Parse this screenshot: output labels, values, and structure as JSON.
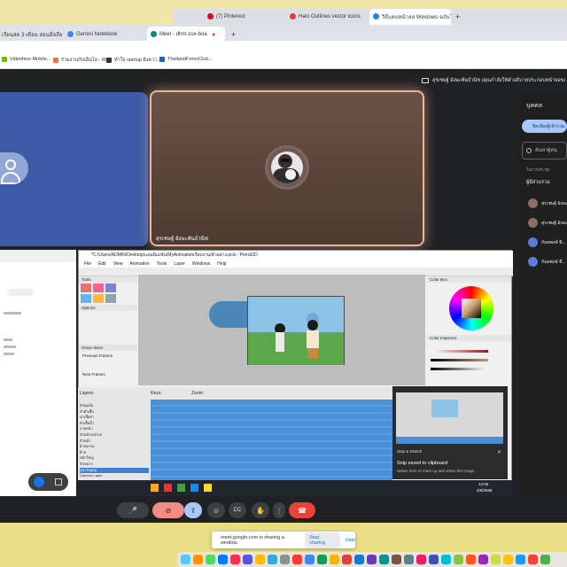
{
  "browser_back": {
    "tabs": [
      {
        "label": "(7) Pinterest",
        "color": "#e60023"
      },
      {
        "label": "Hats Outlines vector icons",
        "color": "#e53935"
      },
      {
        "label": "วิธีแคปหน้าจอ Windows ฉบับไม่...",
        "color": "#1e88e5"
      }
    ],
    "new_tab": "+"
  },
  "browser_front": {
    "tabs": [
      {
        "label": "เรียนสด 3 เดือน สอนมือถือ C...",
        "color": "#f4b400"
      },
      {
        "label": "Gemini Notebook",
        "color": "#4285f4"
      },
      {
        "label": "Meet - dhm-zux-boa",
        "color": "#00897b"
      }
    ],
    "recording_dot": "●",
    "new_tab": "+",
    "bookmarks": [
      {
        "label": "Videohive Mobile...",
        "color": "#76b900"
      },
      {
        "label": "ร่วมงานกับเอ็มไอ - W...",
        "color": "#ff7043"
      },
      {
        "label": "ทำใจ startup ยิงควา...",
        "color": "#333333"
      },
      {
        "label": "ThailandForexClub...",
        "color": "#1565c0"
      }
    ]
  },
  "meet": {
    "presenting_banner": "สุรเชษฐ์ อังษะพันธ์วนิช (คุณกำลังให้คำอธิบายประกอบหน้าจอของคุณ)",
    "presenter_name": "สุรเชษฐ์ อังษะพันธ์วนิช",
    "people_panel": {
      "title": "บุคคล",
      "pill": "ปิดเสียงผู้เข้าร่วม",
      "search_placeholder": "ค้นหาผู้คน",
      "section": "ในการประชุม",
      "group_label": "ผู้มีส่วนร่วม",
      "people": [
        "สุรเชษฐ์ อังษะ...",
        "สุรเชษฐ์ อังษะ...",
        "กันตพงษ์ ที...",
        "กันตพงษ์ ที่..."
      ]
    },
    "controls": {
      "mic": "🎤",
      "cam_off": "⊘",
      "present": "⇪",
      "emoji": "☺",
      "captions": "CC",
      "hand": "✋",
      "more": "⋮",
      "end_call": "☎"
    }
  },
  "shared_screen": {
    "title": "*C:/Users/ADMIN/Desktop/แอนนิเมชั่น/MyAnimationเรียบงาน/ตัวอย่าง.pclx - Pencil2D",
    "menu": [
      "File",
      "Edit",
      "View",
      "Animation",
      "Tools",
      "Layer",
      "Windows",
      "Help"
    ],
    "panels": {
      "tools": "Tools",
      "options": "Options",
      "onion": "Onion Skins",
      "previous_frames": "Previous Frames",
      "next_frames": "Next Frames",
      "color_box": "Color Box",
      "color_inspector": "Color Inspector",
      "timeline": "Timeline - Pencil2D",
      "layers": "Layers:",
      "keys": "Keys:",
      "zoom": "Zoom:"
    },
    "layers": [
      "หัวมุมส้ม",
      "ลำตัวเสื้อ",
      "ขาเสื้อย่า",
      "ตัวเสื้อน้ำ",
      "ลายหน้า",
      "ตัวหน้าเปลาเล่",
      "ตัวหน้า",
      "ผ้าลอกาย",
      "ผ้าล",
      "หน้าใหญ่",
      "หัวหมาก",
      "สุนาขนุดญ่",
      "Camera Layer"
    ],
    "taskbar_time": "12:05",
    "taskbar_date": "2/8/2568",
    "toast": {
      "header": "Snip & Sketch",
      "title": "Snip saved to clipboard",
      "body": "Select here to mark up and share the image"
    }
  },
  "share_notice": {
    "text": "meet.google.com is sharing a window.",
    "stop": "Stop sharing",
    "hide": "Hide"
  }
}
